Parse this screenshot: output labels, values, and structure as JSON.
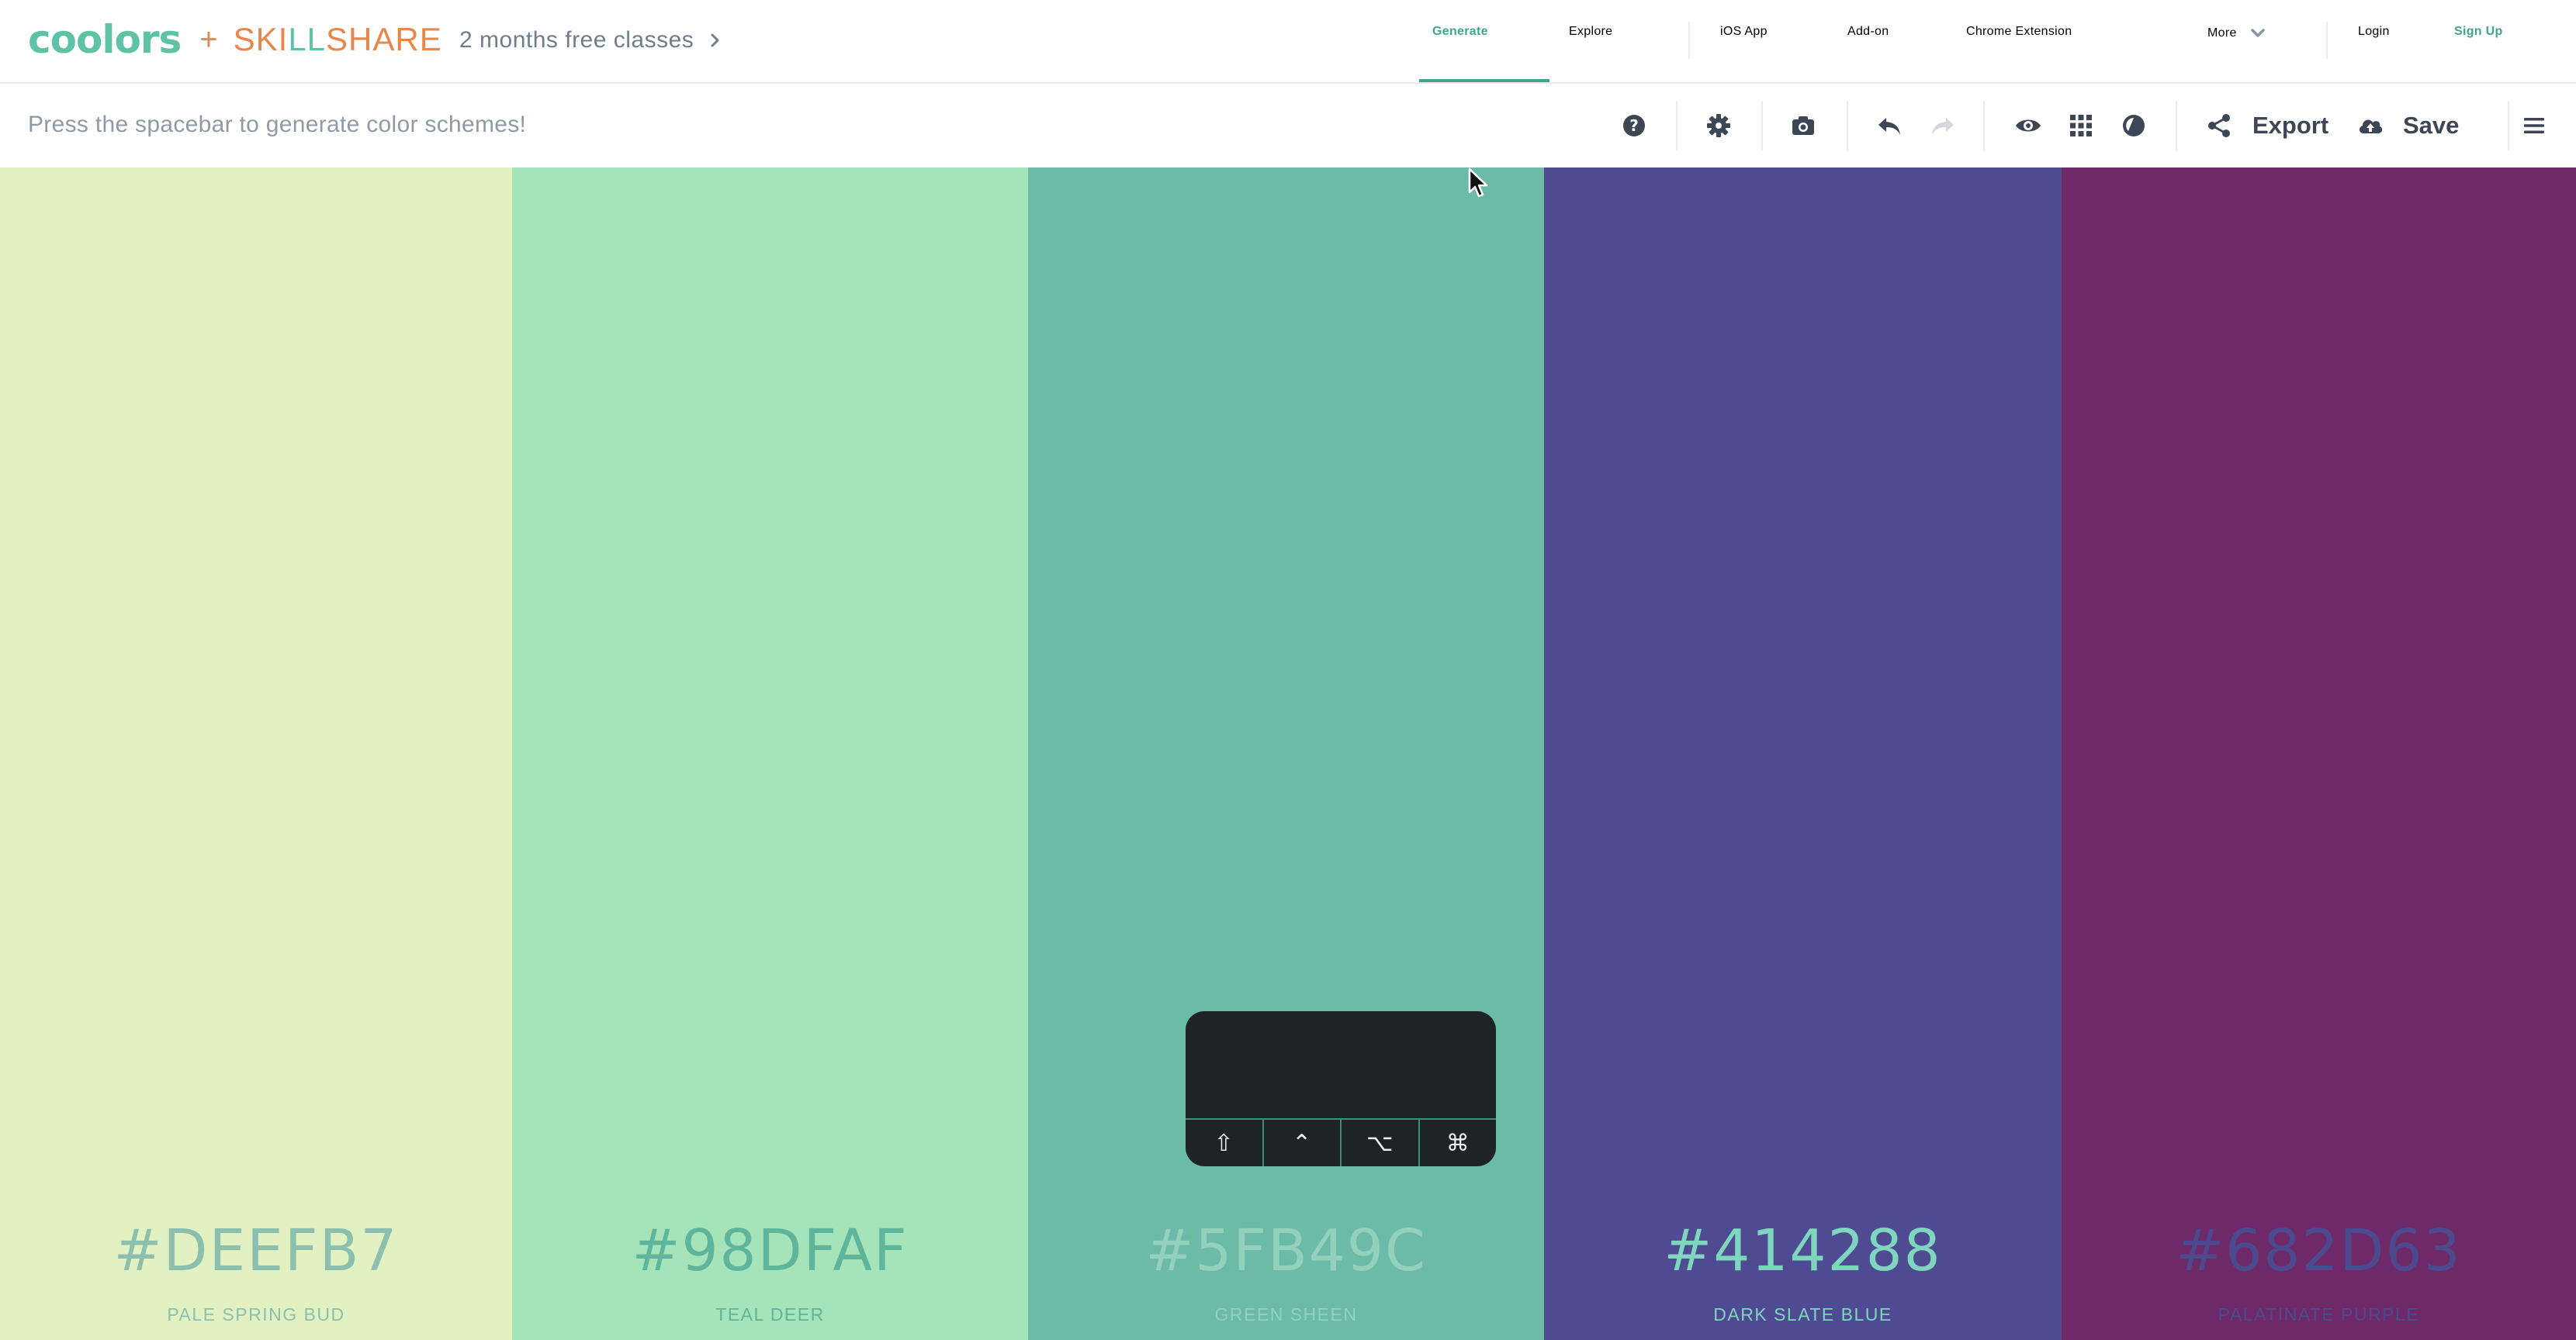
{
  "nav": {
    "logo": "coolors",
    "plus": "+",
    "partner": "SKILLSHARE",
    "partner_letter_colors": [
      "#e6884e",
      "#e6884e",
      "#e6884e",
      "#5ec3a6",
      "#5ec3a6",
      "#e6884e",
      "#e6884e",
      "#e6884e",
      "#e6884e",
      "#e6884e"
    ],
    "promo": "2 months free classes",
    "items": {
      "generate": "Generate",
      "explore": "Explore",
      "ios": "iOS App",
      "addon": "Add-on",
      "chrome": "Chrome Extension",
      "more": "More",
      "login": "Login",
      "signup": "Sign Up"
    },
    "accent": "#3fa68b"
  },
  "toolbar": {
    "hint": "Press the spacebar to generate color schemes!",
    "export_label": "Export",
    "save_label": "Save",
    "icons": [
      "help-icon",
      "settings-icon",
      "camera-icon",
      "undo-icon",
      "redo-icon",
      "eye-icon",
      "grid-icon",
      "contrast-icon",
      "share-icon",
      "cloud-upload-icon",
      "menu-icon"
    ]
  },
  "palette": [
    {
      "hex": "#DEEFB7",
      "name": "PALE SPRING BUD",
      "bg": "#e2f1c1",
      "text": "#8cbfae"
    },
    {
      "hex": "#98DFAF",
      "name": "TEAL DEER",
      "bg": "#a5e3b9",
      "text": "#5fb49c"
    },
    {
      "hex": "#5FB49C",
      "name": "GREEN SHEEN",
      "bg": "#6cbba9",
      "text": "#93d1bd"
    },
    {
      "hex": "#414288",
      "name": "DARK SLATE BLUE",
      "bg": "#4f4b93",
      "text": "#7ed6bf"
    },
    {
      "hex": "#682D63",
      "name": "PALATINATE PURPLE",
      "bg": "#6e2a68",
      "text": "#4c4a8f"
    }
  ],
  "keyboard_overlay": {
    "keys": [
      "⇧",
      "⌃",
      "⌥",
      "⌘"
    ]
  }
}
